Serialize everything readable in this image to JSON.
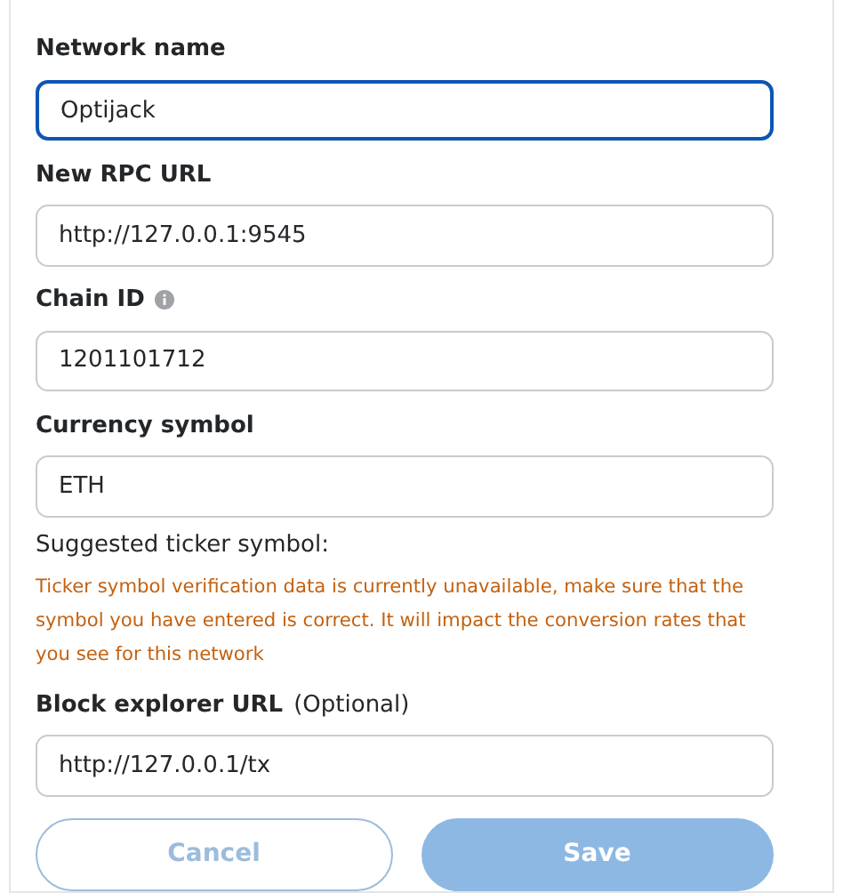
{
  "fields": [
    {
      "label": "Network name",
      "value": "Optijack",
      "focused": true,
      "info": false
    },
    {
      "label": "New RPC URL",
      "value": "http://127.0.0.1:9545",
      "focused": false,
      "info": false
    },
    {
      "label": "Chain ID",
      "value": "1201101712",
      "focused": false,
      "info": true
    },
    {
      "label": "Currency symbol",
      "value": "ETH",
      "focused": false,
      "info": false,
      "suggestion": "Suggested ticker symbol:",
      "warning": "Ticker symbol verification data is currently unavailable, make sure that the symbol you have entered is correct. It will impact the conversion rates that you see for this network"
    },
    {
      "label": "Block explorer URL",
      "optional": "(Optional)",
      "value": "http://127.0.0.1/tx",
      "focused": false,
      "info": false
    }
  ],
  "buttons": [
    {
      "label": "Cancel",
      "kind": "secondary",
      "disabled": true
    },
    {
      "label": "Save",
      "kind": "primary",
      "disabled": true
    }
  ]
}
